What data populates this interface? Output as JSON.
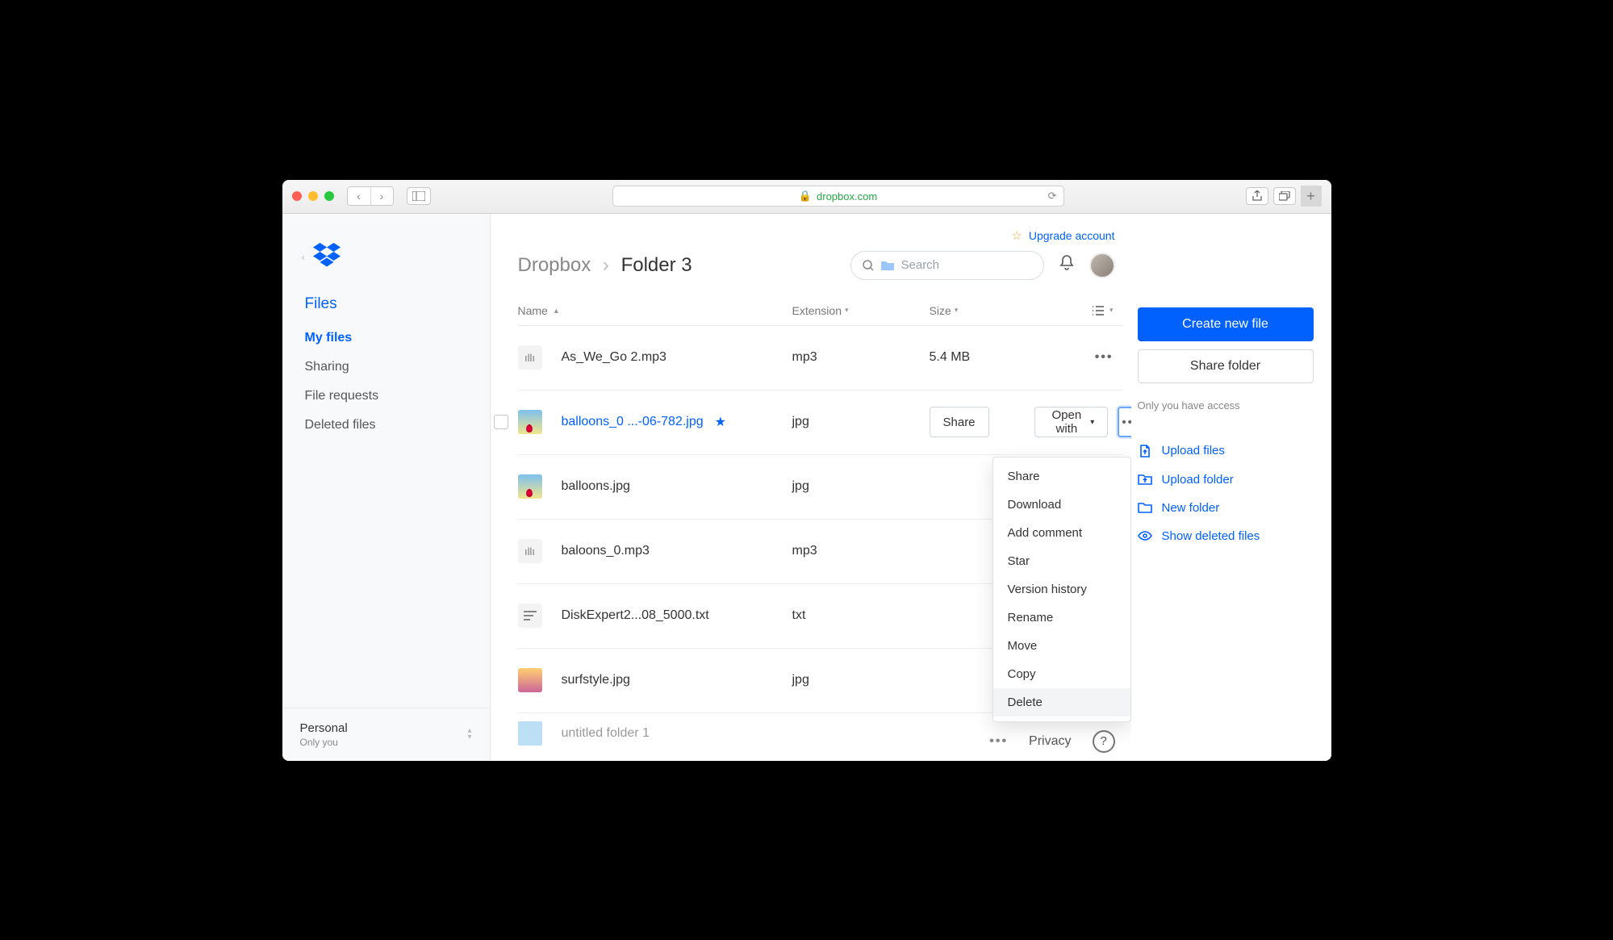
{
  "browser": {
    "url": "dropbox.com"
  },
  "upgrade_label": "Upgrade account",
  "breadcrumb": {
    "root": "Dropbox",
    "current": "Folder 3"
  },
  "search": {
    "placeholder": "Search"
  },
  "sidebar": {
    "heading": "Files",
    "items": [
      "My files",
      "Sharing",
      "File requests",
      "Deleted files"
    ],
    "account": {
      "label": "Personal",
      "sub": "Only you"
    }
  },
  "columns": {
    "name": "Name",
    "ext": "Extension",
    "size": "Size"
  },
  "files": [
    {
      "name": "As_We_Go 2.mp3",
      "ext": "mp3",
      "size": "5.4 MB",
      "icon": "audio"
    },
    {
      "name": "balloons_0 ...-06-782.jpg",
      "ext": "jpg",
      "size": "",
      "icon": "imgb",
      "selected": true,
      "starred": true
    },
    {
      "name": "balloons.jpg",
      "ext": "jpg",
      "size": "",
      "icon": "imgb"
    },
    {
      "name": "baloons_0.mp3",
      "ext": "mp3",
      "size": "",
      "icon": "audio"
    },
    {
      "name": "DiskExpert2...08_5000.txt",
      "ext": "txt",
      "size": "",
      "icon": "txt"
    },
    {
      "name": "surfstyle.jpg",
      "ext": "jpg",
      "size": "",
      "icon": "surf"
    },
    {
      "name": "untitled folder 1",
      "ext": "",
      "size": "",
      "icon": "folder"
    }
  ],
  "row_actions": {
    "share": "Share",
    "open_with": "Open with"
  },
  "context_menu": [
    "Share",
    "Download",
    "Add comment",
    "Star",
    "Version history",
    "Rename",
    "Move",
    "Copy",
    "Delete"
  ],
  "right": {
    "create": "Create new file",
    "share_folder": "Share folder",
    "access": "Only you have access",
    "actions": [
      "Upload files",
      "Upload folder",
      "New folder",
      "Show deleted files"
    ]
  },
  "footer": {
    "privacy": "Privacy"
  }
}
